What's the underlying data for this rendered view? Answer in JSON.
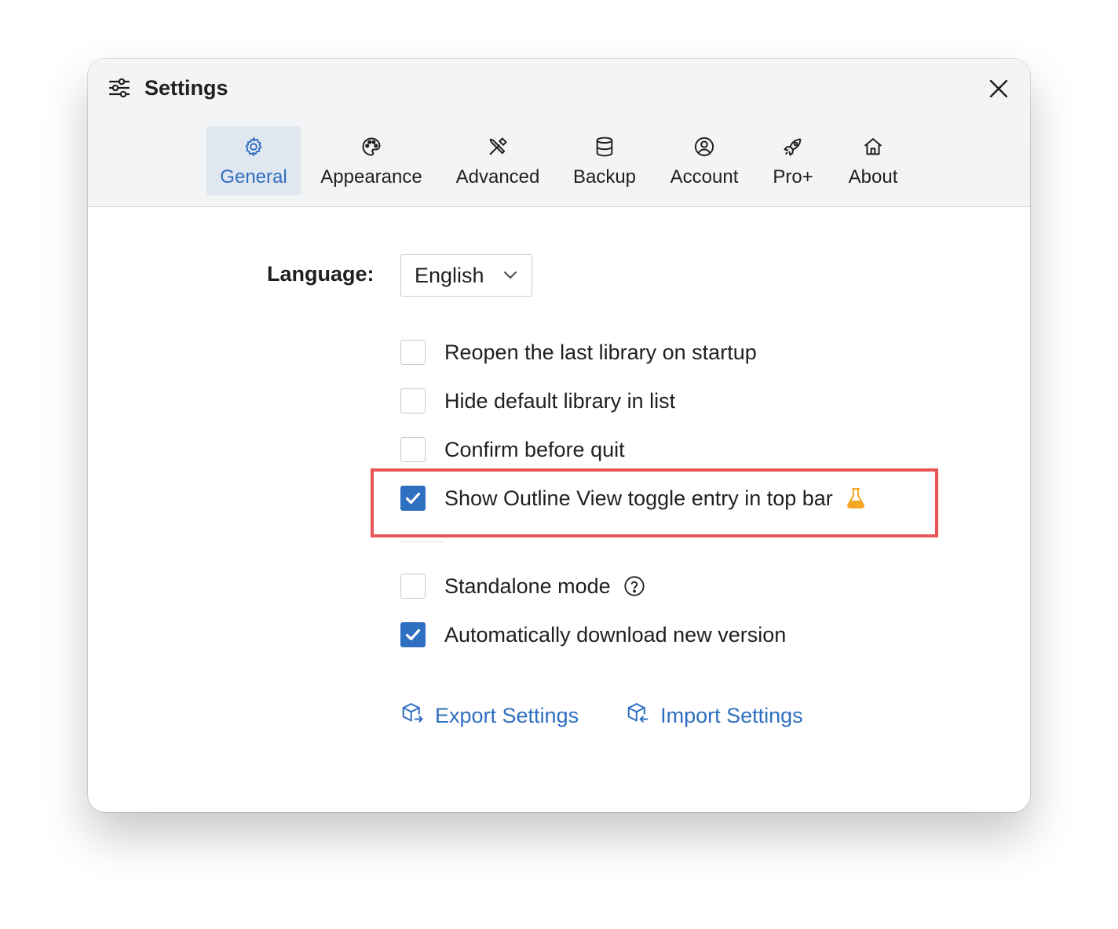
{
  "window": {
    "title": "Settings"
  },
  "tabs": [
    {
      "label": "General",
      "icon": "gear-icon",
      "active": true
    },
    {
      "label": "Appearance",
      "icon": "palette-icon",
      "active": false
    },
    {
      "label": "Advanced",
      "icon": "tools-icon",
      "active": false
    },
    {
      "label": "Backup",
      "icon": "database-icon",
      "active": false
    },
    {
      "label": "Account",
      "icon": "user-circle-icon",
      "active": false
    },
    {
      "label": "Pro+",
      "icon": "rocket-icon",
      "active": false
    },
    {
      "label": "About",
      "icon": "home-icon",
      "active": false
    }
  ],
  "general": {
    "language_label": "Language:",
    "language_value": "English",
    "options": [
      {
        "label": "Reopen the last library on startup",
        "checked": false
      },
      {
        "label": "Hide default library in list",
        "checked": false
      },
      {
        "label": "Confirm before quit",
        "checked": false
      },
      {
        "label": "Show Outline View toggle entry in top bar",
        "checked": true,
        "icon": "flask-icon"
      },
      {
        "label": "Standalone mode",
        "checked": false,
        "icon": "help-circle-icon"
      },
      {
        "label": "Automatically download new version",
        "checked": true
      }
    ],
    "export_label": "Export Settings",
    "import_label": "Import Settings"
  },
  "colors": {
    "accent": "#2f6fc0",
    "highlight": "#ea5455",
    "flask": "#f5a623"
  }
}
